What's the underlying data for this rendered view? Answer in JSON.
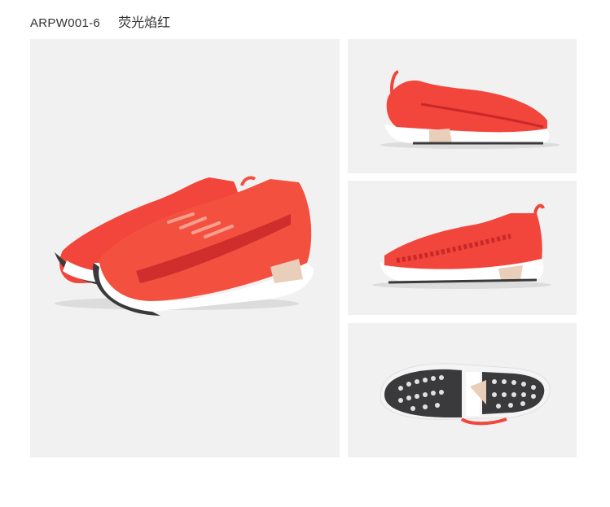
{
  "product": {
    "code": "ARPW001-6",
    "color_name": "荧光焰红"
  },
  "images": [
    {
      "name": "shoe-pair-front-view"
    },
    {
      "name": "shoe-side-view-left"
    },
    {
      "name": "shoe-side-view-right"
    },
    {
      "name": "shoe-outsole-view"
    }
  ],
  "colors": {
    "upper": "#f2453b",
    "upper_dark": "#c8282a",
    "sole": "#ffffff",
    "outsole": "#3a3a3c",
    "accent_tan": "#e9cfb9",
    "panel_bg": "#f1f1f1"
  }
}
